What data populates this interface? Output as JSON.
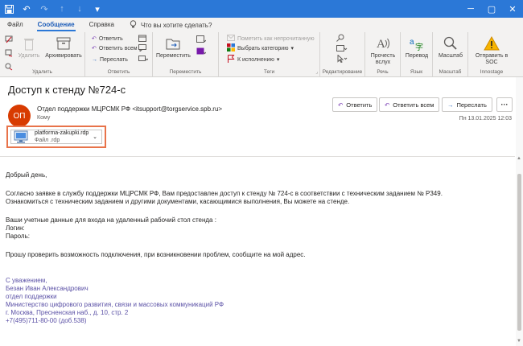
{
  "titlebar": {
    "quick_access": [
      "save-icon",
      "undo-icon",
      "redo-icon",
      "up-icon",
      "down-icon",
      "customize-icon"
    ],
    "controls": [
      "minimize-icon",
      "maximize-icon",
      "close-icon"
    ]
  },
  "tabs": [
    {
      "label": "Файл"
    },
    {
      "label": "Сообщение"
    },
    {
      "label": "Справка"
    }
  ],
  "tell_me": "Что вы хотите сделать?",
  "ribbon": {
    "delete_group": {
      "label": "Удалить",
      "delete": "Удалить",
      "archive": "Архивировать"
    },
    "respond_group": {
      "label": "Ответить",
      "reply": "Ответить",
      "reply_all": "Ответить всем",
      "forward": "Переслать"
    },
    "move_group": {
      "label": "Переместить",
      "move": "Переместить"
    },
    "tags_group": {
      "label": "Теги",
      "mark_unread": "Пометить как непрочитанную",
      "categorize": "Выбрать категорию",
      "follow_up": "К исполнению"
    },
    "editing_group": {
      "label": "Редактирование"
    },
    "speech_group": {
      "label": "Речь",
      "read_aloud": "Прочесть вслух"
    },
    "language_group": {
      "label": "Язык",
      "translate": "Перевод"
    },
    "zoom_group": {
      "label": "Масштаб",
      "zoom": "Масштаб"
    },
    "innostage_group": {
      "label": "Innostage",
      "send_soc": "Отправить в SOC"
    }
  },
  "message": {
    "subject": "Доступ к стенду №724-с",
    "avatar_initials": "ОП",
    "avatar_color": "#d83b01",
    "sender": "Отдел поддержки МЦРСМК РФ <itsupport@torgservice.spb.ru>",
    "to_label": "Кому",
    "date": "Пн 13.01.2025 12:03",
    "actions": {
      "reply": "Ответить",
      "reply_all": "Ответить всем",
      "forward": "Переслать",
      "more": "···"
    },
    "attachment": {
      "name": "platforma-zakupki.rdp",
      "type": "Файл .rdp",
      "highlight_color": "#e8734a"
    },
    "body": {
      "greeting": "Добрый день,",
      "para1_line1": "Согласно заявке в службу поддержки МЦРСМК РФ, Вам предоставлен доступ к стенду № 724-с в соответствии с техническим заданием № Р349.",
      "para1_line2": "Ознакомиться с техническим заданием и другими документами, касающимися выполнения, Вы можете на стенде.",
      "creds_intro": "Ваши учетные данные для входа на удаленный рабочий стол стенда :",
      "login": "Логин:",
      "password": "Пароль:",
      "request": "Прошу проверить возможность подключения, при возникновении проблем, сообщите на мой адрес.",
      "signature": [
        "С уважением,",
        "Безан Иван Александрович",
        "отдел поддержки",
        "Министерство цифрового развития, связи и массовых коммуникаций РФ",
        "г. Москва, Пресненская наб., д. 10, стр. 2",
        "+7(495)711-80-00 (доб.538)"
      ],
      "signature_color": "#5b51a6"
    }
  }
}
